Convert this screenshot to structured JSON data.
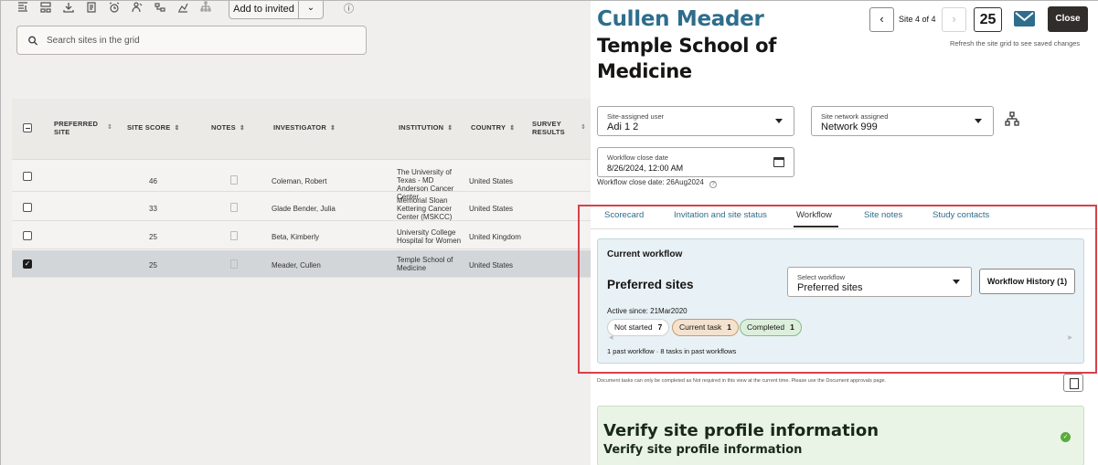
{
  "toolbar": {
    "add_invited_label": "Add to invited",
    "icons": [
      "columns-icon",
      "layout-icon",
      "download-icon",
      "report-icon",
      "alarm-icon",
      "person-icon",
      "network-icon",
      "chart-icon",
      "hierarchy-icon"
    ]
  },
  "search": {
    "placeholder": "Search sites in the grid"
  },
  "grid": {
    "headers": {
      "preferred_site": "PREFERRED SITE",
      "site_score": "SITE SCORE",
      "notes": "NOTES",
      "investigator": "INVESTIGATOR",
      "institution": "INSTITUTION",
      "country": "COUNTRY",
      "survey_results": "SURVEY RESULTS"
    },
    "rows": [
      {
        "score": "46",
        "investigator": "Coleman, Robert",
        "institution": "The University of Texas - MD Anderson Cancer Center",
        "country": "United States",
        "checked": false
      },
      {
        "score": "33",
        "investigator": "Glade Bender, Julia",
        "institution": "Memorial Sloan Kettering Cancer Center (MSKCC)",
        "country": "United States",
        "checked": false
      },
      {
        "score": "25",
        "investigator": "Beta, Kimberly",
        "institution": "University College Hospital for Women",
        "country": "United Kingdom",
        "checked": false
      },
      {
        "score": "25",
        "investigator": "Meader, Cullen",
        "institution": "Temple School of Medicine",
        "country": "United States",
        "checked": true
      }
    ]
  },
  "panel": {
    "investigator_name": "Cullen Meader",
    "site_name": "Temple School of Medicine",
    "site_position": "Site 4 of 4",
    "count": "25",
    "close_label": "Close",
    "refresh_note": "Refresh the site grid to see saved changes",
    "site_user": {
      "label": "Site-assigned user",
      "value": "Adi 1 2"
    },
    "network": {
      "label": "Site network assigned",
      "value": "Network 999"
    },
    "workflow_close": {
      "label": "Workflow close date",
      "value": "8/26/2024, 12:00 AM"
    },
    "close_date_note": "Workflow close date: 26Aug2024",
    "tabs": [
      "Scorecard",
      "Invitation and site status",
      "Workflow",
      "Site notes",
      "Study contacts"
    ],
    "active_tab": "Workflow",
    "workflow": {
      "title": "Current workflow",
      "name": "Preferred sites",
      "select_label": "Select workflow",
      "select_value": "Preferred sites",
      "history_label": "Workflow History (1)",
      "active_since": "Active since: 21Mar2020",
      "not_started": {
        "label": "Not started",
        "count": "7"
      },
      "current_task": {
        "label": "Current task",
        "count": "1"
      },
      "completed": {
        "label": "Completed",
        "count": "1"
      },
      "past_summary": "1 past workflow · 8 tasks in past workflows"
    },
    "doc_note": "Document tasks can only be completed as Not required in this view at the current time. Please use the Document approvals page.",
    "verify": {
      "title": "Verify site profile information",
      "subtitle": "Verify site profile information"
    }
  },
  "colors": {
    "accent": "#2e6d8c",
    "highlight": "#d9404a",
    "close_button": "#312d2a"
  }
}
